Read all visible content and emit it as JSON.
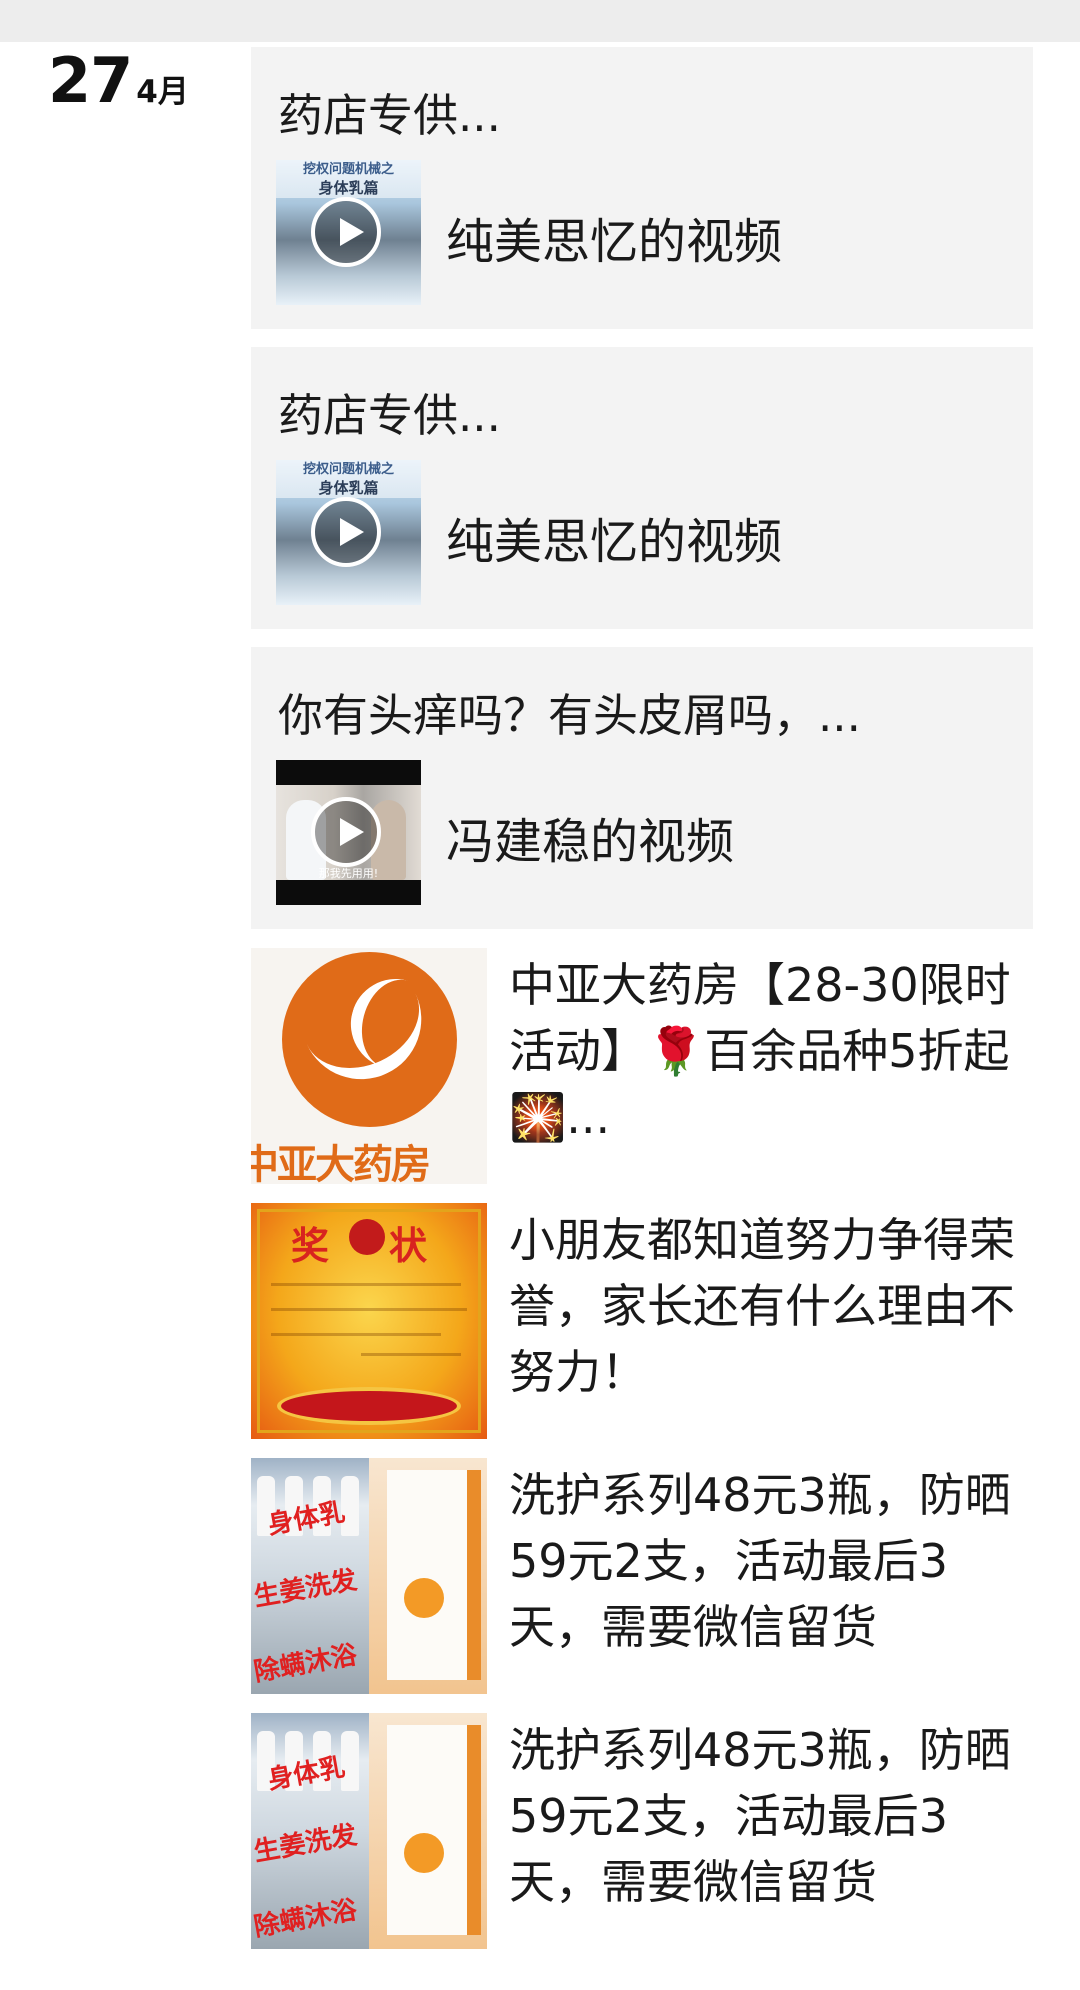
{
  "date": {
    "day": "27",
    "month": "4月"
  },
  "video_posts": [
    {
      "title": "药店专供...",
      "video_name": "纯美思忆的视频",
      "thumb_caption_1": "挖权问题机械之",
      "thumb_caption_2": "身体乳篇"
    },
    {
      "title": "药店专供...",
      "video_name": "纯美思忆的视频",
      "thumb_caption_1": "挖权问题机械之",
      "thumb_caption_2": "身体乳篇"
    },
    {
      "title": "你有头痒吗？有头皮屑吗，...",
      "video_name": "冯建稳的视频",
      "thumb_subtitle": "那我先用用!"
    }
  ],
  "articles": [
    {
      "text": "中亚大药房【28-30限时活动】🌹百余品种5折起🎇...",
      "thumb_text": "中亚大药房"
    },
    {
      "text": "小朋友都知道努力争得荣誉，家长还有什么理由不努力！",
      "thumb_text": "奖状"
    },
    {
      "text": "洗护系列48元3瓶，防晒59元2支，活动最后3天，需要微信留货",
      "thumb_text_1": "身体乳",
      "thumb_text_2": "生姜洗发",
      "thumb_text_3": "除螨沐浴"
    },
    {
      "text": "洗护系列48元3瓶，防晒59元2支，活动最后3天，需要微信留货",
      "thumb_text_1": "身体乳",
      "thumb_text_2": "生姜洗发",
      "thumb_text_3": "除螨沐浴"
    }
  ],
  "icons": {
    "play": "play-icon"
  },
  "colors": {
    "card_bg": "#f3f3f3",
    "brand_orange": "#e06b18",
    "promo_red": "#e02020"
  }
}
